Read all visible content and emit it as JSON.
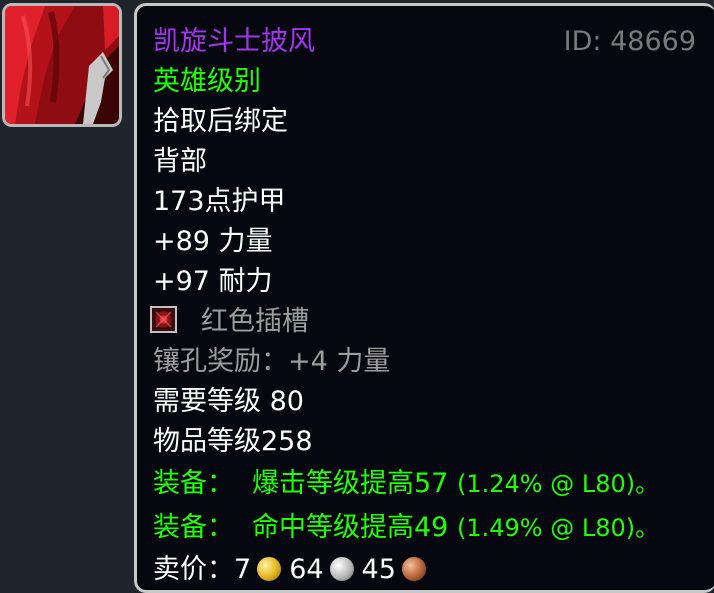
{
  "item": {
    "name": "凯旋斗士披风",
    "id_label": "ID: 48669",
    "quality": "英雄级别",
    "bind": "拾取后绑定",
    "slot": "背部",
    "armor": "173点护甲",
    "stats": [
      "+89 力量",
      "+97 耐力"
    ],
    "socket": {
      "label": "红色插槽",
      "icon": "red-socket-icon"
    },
    "socket_bonus": "镶孔奖励：+4 力量",
    "required_level": "需要等级 80",
    "item_level": "物品等级258",
    "equip_effects": [
      {
        "prefix": "装备：",
        "text": "爆击等级提高57",
        "detail": "(1.24% @ L80)。"
      },
      {
        "prefix": "装备：",
        "text": "命中等级提高49",
        "detail": "(1.49% @ L80)。"
      }
    ],
    "sell_price": {
      "label": "卖价：",
      "gold": "7",
      "silver": "64",
      "copper": "45"
    }
  },
  "icon": {
    "name": "red-cloak-icon"
  },
  "colors": {
    "epic": "#a335ee",
    "uncommon_green": "#1eff00",
    "gray": "#9d9d9d",
    "tooltip_bg": "#07080f"
  }
}
